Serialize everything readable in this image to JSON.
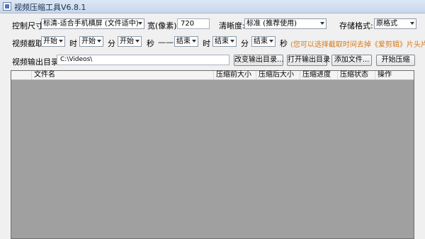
{
  "window": {
    "title": "视频压缩工具V6.8.1",
    "icon": "app-icon"
  },
  "row1": {
    "size_label": "控制尺寸:",
    "size_value": "标清-适合手机横屏 (文件适中)",
    "width_label": "宽(像素):",
    "width_value": "720",
    "clarity_label": "清晰度:",
    "clarity_value": "标准 (推荐使用)",
    "format_label": "存储格式:",
    "format_value": "原格式"
  },
  "row2": {
    "clip_label": "视频截取:",
    "start_h": "开始",
    "hour_label": "时",
    "start_m": "开始",
    "minute_label": "分",
    "start_s": "开始",
    "second_label": "秒",
    "dash": "——",
    "end_h": "结束",
    "hour_label2": "时",
    "end_m": "结束",
    "minute_label2": "分",
    "end_s": "结束",
    "second_label2": "秒",
    "hint": "(您可以选择截取时间去掉《爱剪辑》片头片尾)"
  },
  "row3": {
    "output_label": "视频输出目录:",
    "output_path": "C:\\Videos\\",
    "change_dir_button": "改变输出目录...",
    "open_dir_button": "打开输出目录",
    "add_file_button": "添加文件...",
    "start_button": "开始压缩"
  },
  "table": {
    "columns": [
      "文件名",
      "压缩前大小",
      "压缩后大小",
      "压缩进度",
      "压缩状态",
      "操作"
    ]
  }
}
